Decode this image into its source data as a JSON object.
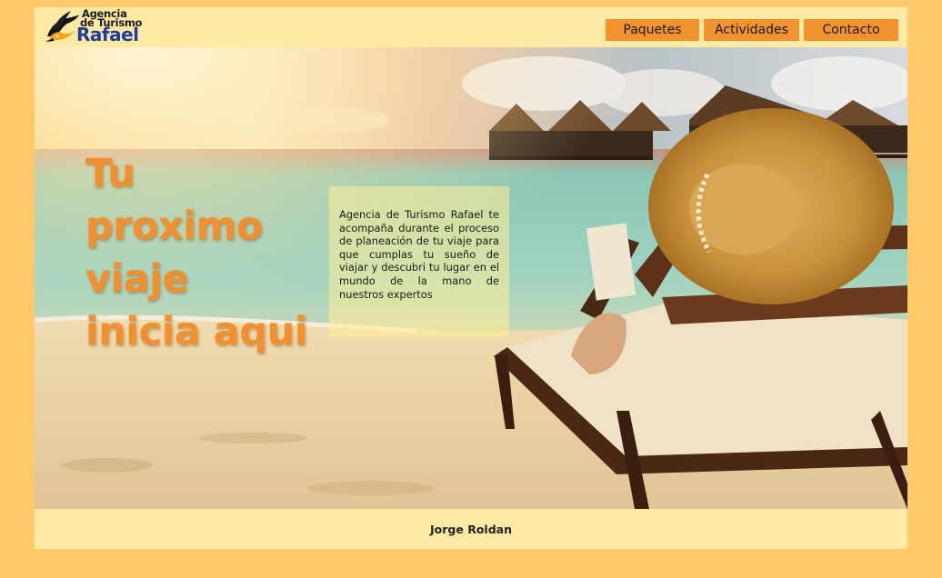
{
  "logo": {
    "line1": "Agencia",
    "line2": "de Turismo",
    "brand": "Rafael",
    "icon": "toucan-bird-icon",
    "brand_color": "#1d3d9c"
  },
  "nav": {
    "items": [
      {
        "label": "Paquetes"
      },
      {
        "label": "Actividades"
      },
      {
        "label": "Contacto"
      }
    ],
    "button_color": "#f39330"
  },
  "hero": {
    "title": "Tu proximo viaje inicia aqui",
    "description": "Agencia de Turismo Rafael te acompaña durante el proceso de planeación de tu viaje para que cumplas tu sueño de viajar y descubri tu lugar en el mundo de la mano de nuestros expertos",
    "title_color": "#f28f2e"
  },
  "footer": {
    "name": "Jorge Roldan"
  },
  "colors": {
    "page_background": "#ffc96a",
    "content_background": "#ffeaa5"
  }
}
